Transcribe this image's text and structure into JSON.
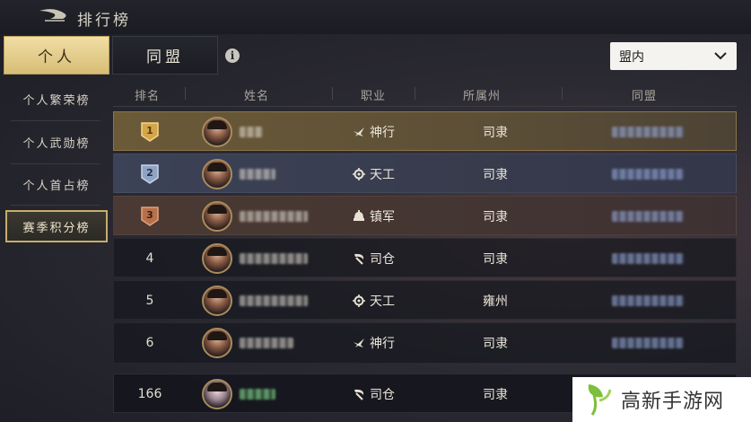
{
  "header": {
    "title": "排行榜"
  },
  "tabs": [
    {
      "label": "个人",
      "active": true
    },
    {
      "label": "同盟",
      "active": false
    }
  ],
  "info": {
    "glyph": "i"
  },
  "filter": {
    "selected": "盟内"
  },
  "sidebar": {
    "items": [
      {
        "label": "个人繁荣榜",
        "active": false
      },
      {
        "label": "个人武勋榜",
        "active": false
      },
      {
        "label": "个人首占榜",
        "active": false
      },
      {
        "label": "赛季积分榜",
        "active": true
      }
    ]
  },
  "table": {
    "columns": [
      "排名",
      "姓名",
      "职业",
      "所属州",
      "同盟"
    ],
    "rows": [
      {
        "rank": "1",
        "job": "神行",
        "job_icon": "bird-icon",
        "state": "司隶",
        "medal": "gold"
      },
      {
        "rank": "2",
        "job": "天工",
        "job_icon": "gear-icon",
        "state": "司隶",
        "medal": "silver"
      },
      {
        "rank": "3",
        "job": "镇军",
        "job_icon": "helmet-icon",
        "state": "司隶",
        "medal": "bronze"
      },
      {
        "rank": "4",
        "job": "司仓",
        "job_icon": "sickle-icon",
        "state": "司隶"
      },
      {
        "rank": "5",
        "job": "天工",
        "job_icon": "gear-icon",
        "state": "雍州"
      },
      {
        "rank": "6",
        "job": "神行",
        "job_icon": "bird-icon",
        "state": "司隶"
      }
    ],
    "self_row": {
      "rank": "166",
      "job": "司仓",
      "job_icon": "sickle-icon",
      "state": "司隶"
    }
  },
  "watermark": {
    "text": "高新手游网"
  },
  "colors": {
    "accent_gold": "#d7bd76",
    "background": "#23242b"
  }
}
